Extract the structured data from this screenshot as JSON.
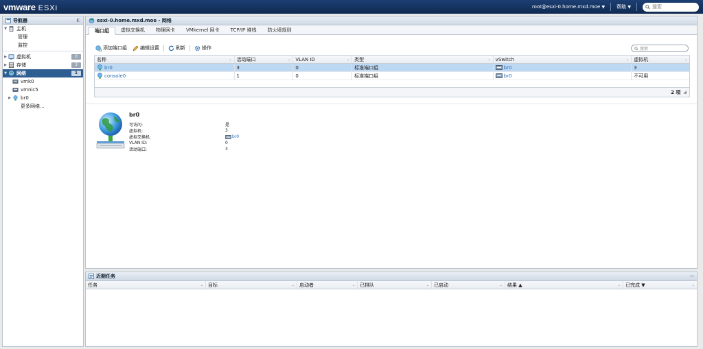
{
  "topbar": {
    "brand_vm": "vmware",
    "brand_esxi": "ESXi",
    "user": "root@esxi-0.home.mxd.moe",
    "help": "帮助",
    "search_placeholder": "搜索"
  },
  "navigator": {
    "title": "导航器",
    "host": "主机",
    "manage": "管理",
    "monitor": "监控",
    "vms": "虚拟机",
    "vms_count": "0",
    "storage": "存储",
    "storage_count": "3",
    "network": "网络",
    "network_count": "1",
    "vmk0": "vmk0",
    "vmnic5": "vmnic5",
    "br0": "br0",
    "more_networks": "更多网络..."
  },
  "main": {
    "title": "esxi-0.home.mxd.moe - 网络",
    "tabs": [
      "端口组",
      "虚拟交换机",
      "物理网卡",
      "VMkernel 网卡",
      "TCP/IP 堆栈",
      "防火墙规则"
    ],
    "toolbar": {
      "add": "添加端口组",
      "edit": "编辑设置",
      "refresh": "刷新",
      "actions": "操作"
    },
    "search_placeholder": "搜索",
    "grid": {
      "headers": [
        "名称",
        "活动端口",
        "VLAN ID",
        "类型",
        "vSwitch",
        "虚拟机"
      ],
      "rows": [
        {
          "name": "br0",
          "active_ports": "3",
          "vlan": "0",
          "type": "标准端口组",
          "vswitch": "br0",
          "vms": "3"
        },
        {
          "name": "console0",
          "active_ports": "1",
          "vlan": "0",
          "type": "标准端口组",
          "vswitch": "br0",
          "vms": "不可用"
        }
      ],
      "count": "2 项"
    },
    "detail": {
      "title": "br0",
      "props": [
        {
          "k": "可访问:",
          "v": "是"
        },
        {
          "k": "虚拟机:",
          "v": "3"
        },
        {
          "k": "虚拟交换机:",
          "v": "br0"
        },
        {
          "k": "VLAN ID:",
          "v": "0"
        },
        {
          "k": "活动端口:",
          "v": "3"
        }
      ]
    }
  },
  "tasks": {
    "title": "近期任务",
    "headers": [
      "任务",
      "目标",
      "启动者",
      "已排队",
      "已启动",
      "结果 ▲",
      "已完成 ▼"
    ]
  },
  "colors": {
    "topbar": "#102a52",
    "selected_nav": "#2e5d91",
    "selected_row": "#bcd8f3",
    "link": "#2a6bb5"
  }
}
